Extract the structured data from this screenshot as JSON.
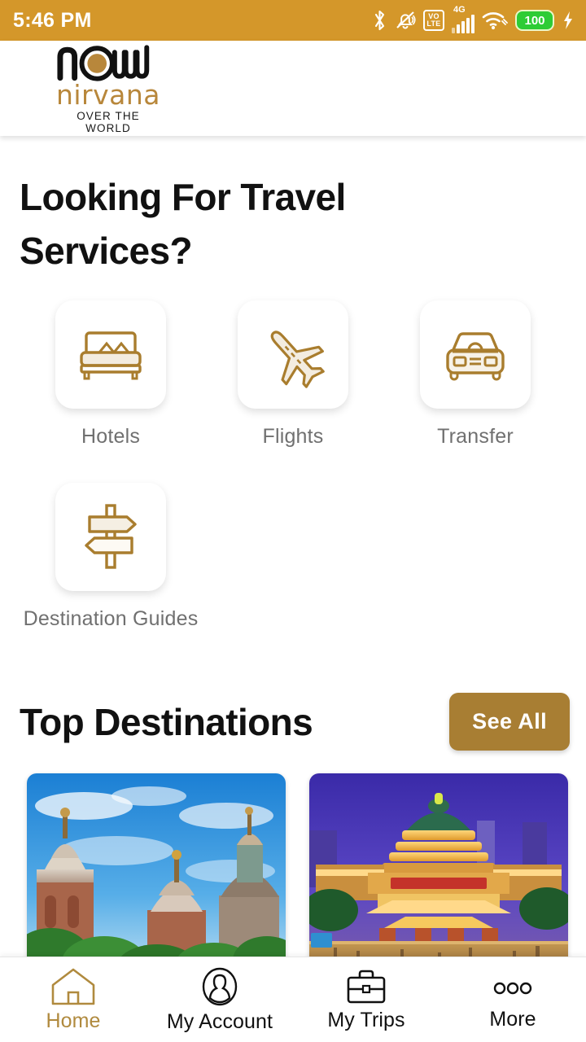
{
  "status_bar": {
    "time": "5:46 PM",
    "battery_level": "100",
    "network_label": "4G",
    "volte_top": "VO",
    "volte_bottom": "LTE",
    "icons": [
      "bluetooth-icon",
      "bell-muted-icon",
      "volte-icon",
      "signal-4g-icon",
      "wifi-icon",
      "battery-icon",
      "charging-bolt-icon"
    ],
    "bg_color": "#d4972a"
  },
  "header": {
    "logo_word": "now",
    "logo_brand": "nirvana",
    "logo_tagline": "OVER THE WORLD",
    "brand_gold": "#b8873b"
  },
  "main": {
    "heading": "Looking For Travel Services?",
    "services": [
      {
        "label": "Hotels",
        "icon": "bed-icon"
      },
      {
        "label": "Flights",
        "icon": "airplane-icon"
      },
      {
        "label": "Transfer",
        "icon": "car-icon"
      },
      {
        "label": "Destination Guides",
        "icon": "signpost-icon"
      }
    ],
    "destinations_title": "Top Destinations",
    "see_all_label": "See All",
    "destination_cards": [
      {
        "name": "temple-domes-photo",
        "alt": "Heritage temple domes under blue sky"
      },
      {
        "name": "illuminated-palace-photo",
        "alt": "Illuminated oriental palace at night"
      }
    ],
    "accent_color": "#a87e33"
  },
  "bottom_nav": {
    "items": [
      {
        "label": "Home",
        "icon": "home-icon",
        "active": true
      },
      {
        "label": "My Account",
        "icon": "person-circle-icon",
        "active": false
      },
      {
        "label": "My Trips",
        "icon": "briefcase-icon",
        "active": false
      },
      {
        "label": "More",
        "icon": "ellipsis-icon",
        "active": false
      }
    ]
  }
}
